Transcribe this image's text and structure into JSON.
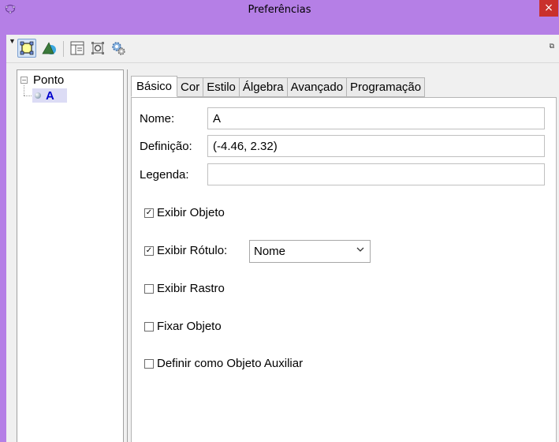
{
  "window": {
    "title": "Preferências",
    "close_glyph": "×",
    "app_icon": "geogebra-icon"
  },
  "toolbar": {
    "icons": [
      "point-style-icon",
      "graphics-icon",
      "layout-icon",
      "defaults-icon",
      "settings-gear-icon"
    ]
  },
  "tree": {
    "root_label": "Ponto",
    "items": [
      {
        "label": "A",
        "color": "#0000cc"
      }
    ]
  },
  "tabs": [
    "Básico",
    "Cor",
    "Estilo",
    "Álgebra",
    "Avançado",
    "Programação"
  ],
  "active_tab": "Básico",
  "fields": {
    "nome_label": "Nome:",
    "nome_value": "A",
    "definicao_label": "Definição:",
    "definicao_value": "(-4.46, 2.32)",
    "legenda_label": "Legenda:",
    "legenda_value": ""
  },
  "checks": {
    "exibir_objeto": {
      "label": "Exibir Objeto",
      "checked": true
    },
    "exibir_rotulo": {
      "label": "Exibir Rótulo:",
      "checked": true
    },
    "exibir_rastro": {
      "label": "Exibir Rastro",
      "checked": false
    },
    "fixar_objeto": {
      "label": "Fixar Objeto",
      "checked": false
    },
    "objeto_auxiliar": {
      "label": "Definir como Objeto Auxiliar",
      "checked": false
    }
  },
  "label_select": {
    "value": "Nome"
  },
  "colors": {
    "titlebar": "#b57fe6",
    "close": "#c9302c",
    "selection": "#dcdcf5",
    "point_label": "#0000cc"
  }
}
